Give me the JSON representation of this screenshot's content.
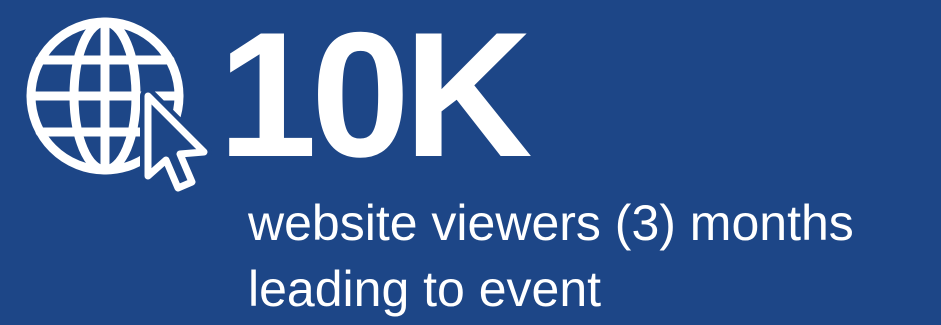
{
  "stat": {
    "icon": "globe-cursor-icon",
    "value": "10K",
    "caption_line1": "website viewers (3) months",
    "caption_line2": "leading to event"
  },
  "colors": {
    "background": "#1d4687",
    "foreground": "#ffffff"
  }
}
